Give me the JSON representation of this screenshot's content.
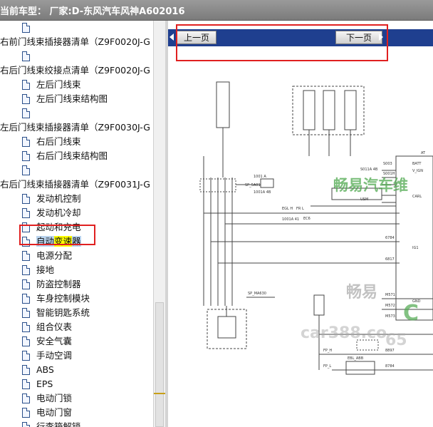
{
  "titlebar": {
    "text": "当前车型：  厂家:D-东风汽车风神A602016"
  },
  "sidebar": {
    "rows": [
      {
        "label": "",
        "indent": 2
      },
      {
        "label": "右前门线束插接器清单（Z9F0020J-G",
        "indent": 0
      },
      {
        "label": "",
        "indent": 2
      },
      {
        "label": "右后门线束绞接点清单（Z9F0020J-G",
        "indent": 0
      },
      {
        "label": "左后门线束",
        "indent": 2
      },
      {
        "label": "左后门线束结构图",
        "indent": 2
      },
      {
        "label": "",
        "indent": 2
      },
      {
        "label": "左后门线束插接器清单（Z9F0030J-G",
        "indent": 0
      },
      {
        "label": "右后门线束",
        "indent": 2
      },
      {
        "label": "右后门线束结构图",
        "indent": 2
      },
      {
        "label": "",
        "indent": 2
      },
      {
        "label": "右后门线束插接器清单（Z9F0031J-G",
        "indent": 0
      },
      {
        "label": "发动机控制",
        "indent": 2
      },
      {
        "label": "发动机冷却",
        "indent": 2
      },
      {
        "label": "起动和充电",
        "indent": 2
      },
      {
        "label": "自动变速器",
        "indent": 2
      },
      {
        "label": "电源分配",
        "indent": 2
      },
      {
        "label": "接地",
        "indent": 2
      },
      {
        "label": "防盗控制器",
        "indent": 2
      },
      {
        "label": "车身控制模块",
        "indent": 2
      },
      {
        "label": "智能钥匙系统",
        "indent": 2
      },
      {
        "label": "组合仪表",
        "indent": 2
      },
      {
        "label": "安全气囊",
        "indent": 2
      },
      {
        "label": "手动空调",
        "indent": 2
      },
      {
        "label": "ABS",
        "indent": 2
      },
      {
        "label": "EPS",
        "indent": 2
      },
      {
        "label": "电动门锁",
        "indent": 2
      },
      {
        "label": "电动门窗",
        "indent": 2
      },
      {
        "label": "行李箱解锁",
        "indent": 2
      }
    ],
    "selected": {
      "a": "自动",
      "b": "变速",
      "c": "器"
    }
  },
  "viewer": {
    "prev_label": "上一页",
    "next_label": "下一页",
    "watermark_main": "畅易汽车维",
    "watermark_2": "畅易",
    "watermark_3": "car388.co",
    "watermark_4": "C",
    "watermark_5": "65",
    "accent": "#1f3f8f",
    "highlight": "#e02020",
    "wire_labels": {
      "l1": "1001 A",
      "l2": "1001A 4B",
      "l3": "S011A 4B",
      "l4": "SP_5A01",
      "l5": "EGL H",
      "l6": "FR L",
      "l7": "EC6",
      "l8": "1001A 41",
      "l9": "S003",
      "l10": "S001H",
      "l11": "BATT",
      "l12": "V_IGN",
      "l13": "CARL",
      "l14": "AT",
      "l15": "USM",
      "l16": "IG1",
      "l17": "GND",
      "l18": "6784",
      "l19": "6817",
      "l20": "M571",
      "l21": "M572",
      "l22": "M573",
      "l23": "FP_H",
      "l24": "FP_L",
      "l25": "SP_MA630",
      "l26": "EBL_ABB",
      "l27": "8784",
      "l28": "8897"
    }
  }
}
